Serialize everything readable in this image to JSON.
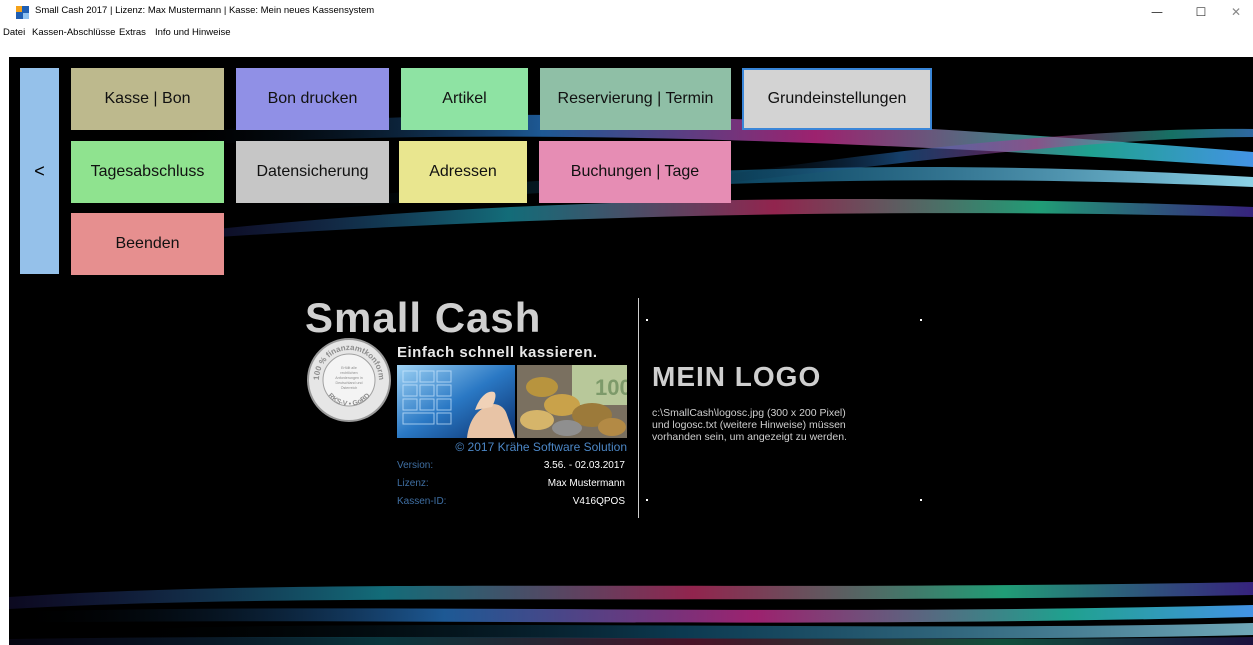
{
  "window": {
    "title": "Small Cash 2017 | Lizenz: Max Mustermann | Kasse: Mein neues Kassensystem",
    "minimize": "—",
    "maximize": "☐",
    "close": "✕"
  },
  "menu": {
    "items": [
      "Datei",
      "Kassen-Abschlüsse",
      "Extras",
      "Info und Hinweise"
    ]
  },
  "nav": {
    "back_label": "<",
    "tiles": [
      {
        "label": "Kasse | Bon",
        "color": "#bdb98d"
      },
      {
        "label": "Bon drucken",
        "color": "#9090e6"
      },
      {
        "label": "Artikel",
        "color": "#8ee3a3"
      },
      {
        "label": "Reservierung | Termin",
        "color": "#8fbfa6"
      },
      {
        "label": "Grundeinstellungen",
        "color": "#d3d3d3"
      },
      {
        "label": "Tagesabschluss",
        "color": "#8fe38f"
      },
      {
        "label": "Datensicherung",
        "color": "#c6c6c6"
      },
      {
        "label": "Adressen",
        "color": "#e9e68f"
      },
      {
        "label": "Buchungen | Tage",
        "color": "#e68db4"
      },
      {
        "label": "Beenden",
        "color": "#e68f8f"
      }
    ]
  },
  "brand": {
    "title": "Small Cash",
    "slogan": "Einfach schnell kassieren.",
    "copyright": "© 2017 Krähe Software Solution",
    "seal": {
      "arc_text": "100 % finanzamtkonform",
      "bottom_text": "RKS-V • GoBD",
      "lines": [
        "Erfüllt alle",
        "rechtlichen",
        "Anforderungen in",
        "Deutschland und",
        "Österreich"
      ]
    },
    "info": [
      {
        "label": "Version:",
        "value": "3.56. - 02.03.2017"
      },
      {
        "label": "Lizenz:",
        "value": "Max Mustermann"
      },
      {
        "label": "Kassen-ID:",
        "value": "V416QPOS"
      }
    ]
  },
  "logo_panel": {
    "title": "MEIN LOGO",
    "lines": [
      "c:\\SmallCash\\logosc.jpg (300 x 200 Pixel)",
      "und logosc.txt (weitere Hinweise) müssen",
      "vorhanden sein, um angezeigt zu werden."
    ]
  },
  "colors": {
    "background": "#000000",
    "back_button": "#95c1ea",
    "selected_border": "#3a86d8",
    "accent_blue": "#4c87c6"
  }
}
